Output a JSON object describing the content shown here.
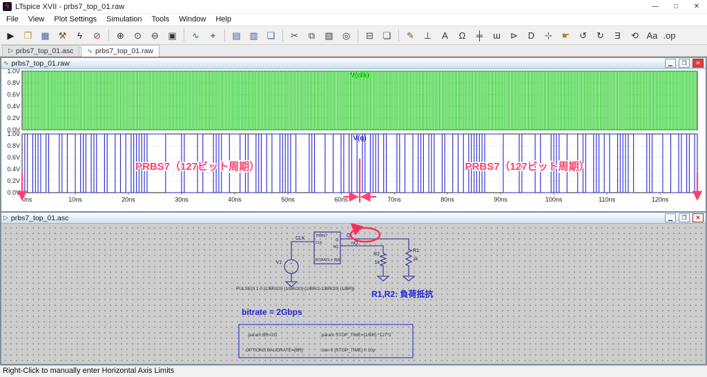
{
  "app": {
    "title": "LTspice XVII - prbs7_top_01.raw",
    "status": "Right-Click to manually enter Horizontal Axis Limits",
    "controls": {
      "minimize": "—",
      "maximize": "□",
      "close": "✕"
    }
  },
  "menu": {
    "items": [
      "File",
      "View",
      "Plot Settings",
      "Simulation",
      "Tools",
      "Window",
      "Help"
    ]
  },
  "toolbar": {
    "icons": [
      {
        "name": "run-icon",
        "glyph": "▶",
        "color": "#222222"
      },
      {
        "name": "open-icon",
        "glyph": "❐",
        "color": "#b98a2f"
      },
      {
        "name": "save-icon",
        "glyph": "▦",
        "color": "#44609a"
      },
      {
        "name": "control-panel-icon",
        "glyph": "⚒",
        "color": "#7a4a28"
      },
      {
        "name": "run-simulation-icon",
        "glyph": "ϟ",
        "color": "#1a1a1a"
      },
      {
        "name": "halt-icon",
        "glyph": "⊘",
        "color": "#b03030"
      },
      {
        "sep": true
      },
      {
        "name": "zoom-in-icon",
        "glyph": "⊕",
        "color": "#333333"
      },
      {
        "name": "zoom-region-icon",
        "glyph": "⊙",
        "color": "#333333"
      },
      {
        "name": "zoom-out-icon",
        "glyph": "⊖",
        "color": "#333333"
      },
      {
        "name": "zoom-full-extents-icon",
        "glyph": "▣",
        "color": "#333333"
      },
      {
        "sep": true
      },
      {
        "name": "plot-settings-icon",
        "glyph": "∿",
        "color": "#2a7a2a"
      },
      {
        "name": "mark-data-point-icon",
        "glyph": "⌖",
        "color": "#333333"
      },
      {
        "sep": true
      },
      {
        "name": "tile-horizontal-icon",
        "glyph": "▤",
        "color": "#3a5a9a"
      },
      {
        "name": "tile-vertical-icon",
        "glyph": "▥",
        "color": "#3a5a9a"
      },
      {
        "name": "cascade-windows-icon",
        "glyph": "❏",
        "color": "#3a5a9a"
      },
      {
        "sep": true
      },
      {
        "name": "cut-icon",
        "glyph": "✂",
        "color": "#444444"
      },
      {
        "name": "copy-icon",
        "glyph": "⧉",
        "color": "#444444"
      },
      {
        "name": "paste-icon",
        "glyph": "▧",
        "color": "#444444"
      },
      {
        "name": "find-icon",
        "glyph": "◎",
        "color": "#333333"
      },
      {
        "sep": true
      },
      {
        "name": "print-icon",
        "glyph": "⊟",
        "color": "#444444"
      },
      {
        "name": "print-preview-icon",
        "glyph": "❑",
        "color": "#444444"
      },
      {
        "sep": true
      },
      {
        "name": "wire-icon",
        "glyph": "✎",
        "color": "#7a5a2a"
      },
      {
        "name": "ground-icon",
        "glyph": "⊥",
        "color": "#333333"
      },
      {
        "name": "label-net-icon",
        "glyph": "A",
        "color": "#333333"
      },
      {
        "name": "resistor-icon",
        "glyph": "Ω",
        "color": "#333333"
      },
      {
        "name": "capacitor-icon",
        "glyph": "╪",
        "color": "#333333"
      },
      {
        "name": "inductor-icon",
        "glyph": "ɯ",
        "color": "#333333"
      },
      {
        "name": "diode-icon",
        "glyph": "⊳",
        "color": "#333333"
      },
      {
        "name": "component-icon",
        "glyph": "D",
        "color": "#333333"
      },
      {
        "name": "move-icon",
        "glyph": "⊹",
        "color": "#333333"
      },
      {
        "name": "drag-icon",
        "glyph": "☛",
        "color": "#b08030"
      },
      {
        "name": "undo-icon",
        "glyph": "↺",
        "color": "#333333"
      },
      {
        "name": "redo-icon",
        "glyph": "↻",
        "color": "#333333"
      },
      {
        "name": "mirror-icon",
        "glyph": "Ǝ",
        "color": "#333333"
      },
      {
        "name": "rotate-icon",
        "glyph": "⟲",
        "color": "#333333"
      },
      {
        "name": "text-icon",
        "glyph": "Aa",
        "color": "#333333"
      },
      {
        "name": "spice-directive-icon",
        "glyph": ".op",
        "color": "#333333"
      }
    ]
  },
  "tabs": [
    {
      "label": "prbs7_top_01.asc",
      "icon": "schematic-file-icon",
      "glyph": "▷",
      "active": false
    },
    {
      "label": "prbs7_top_01.raw",
      "icon": "waveform-file-icon",
      "glyph": "∿",
      "active": true
    }
  ],
  "mdi_controls": {
    "minimize": "▁",
    "restore": "❐",
    "close": "✕"
  },
  "waveform": {
    "window_title": "prbs7_top_01.raw",
    "x_max_ns": 127,
    "y_ticks": [
      "1.0V",
      "0.8V",
      "0.6V",
      "0.4V",
      "0.2V",
      "0.0V"
    ],
    "x_ticks": [
      "0ns",
      "10ns",
      "20ns",
      "30ns",
      "40ns",
      "50ns",
      "60ns",
      "70ns",
      "80ns",
      "90ns",
      "100ns",
      "110ns",
      "120ns"
    ],
    "traces": [
      {
        "name": "V(clk)",
        "color": "#00c400",
        "type": "clock",
        "period_ns": 0.5
      },
      {
        "name": "V(q)",
        "color": "#2424d2",
        "type": "prbs7",
        "bit_ns": 0.5
      }
    ],
    "annotation": {
      "label": "PRBS7（127ビット周期）",
      "color": "#ff4070",
      "period_marker_ns": 63.5,
      "label_centers_ns": [
        33,
        95
      ]
    }
  },
  "schematic": {
    "window_title": "prbs7_top_01.asc",
    "source": {
      "name": "V1",
      "value": "PULSE(0 1 0 {1/BR/20} {1/BR/20} {1/BR/2-1/BR/20} {1/BR})"
    },
    "block": {
      "title": "PRBS7",
      "bitrate": "BITRATE = {BR}",
      "pin_clk": "CLK",
      "pin_q": "Q",
      "pin_nq": "NQ"
    },
    "nets": {
      "clk": "CLK",
      "q": "Q",
      "nq": "nQ"
    },
    "resistors": [
      {
        "name": "R2",
        "value": "1k"
      },
      {
        "name": "R1",
        "value": "1k"
      }
    ],
    "notes": {
      "load": "R1,R2: 負荷抵抗",
      "bitrate": "bitrate = 2Gbps",
      "note_color": "#1f1fd6"
    },
    "directives": [
      ".param BR=2G",
      ".param STOP_TIME={1/BR} *127*2",
      ".OPTIONS BAUDRATE={BR}",
      ".tran 0 {STOP_TIME} 0 10p"
    ],
    "highlight_color": "#ff2d55"
  }
}
